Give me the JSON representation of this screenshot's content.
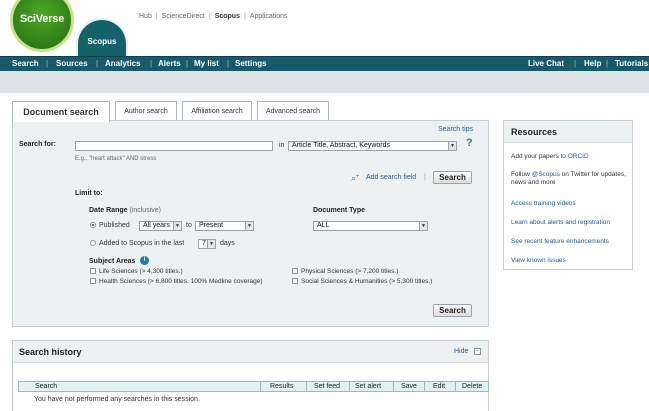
{
  "header": {
    "logo_sciverse": "SciVerse",
    "logo_scopus": "Scopus",
    "top_links": [
      {
        "label": "Hub",
        "active": false
      },
      {
        "label": "ScienceDirect",
        "active": false
      },
      {
        "label": "Scopus",
        "active": true
      },
      {
        "label": "Applications",
        "active": false
      }
    ]
  },
  "nav": {
    "left": [
      "Search",
      "Sources",
      "Analytics",
      "Alerts",
      "My list",
      "Settings"
    ],
    "right": [
      "Live Chat",
      "Help",
      "Tutorials"
    ]
  },
  "search": {
    "tabs": [
      "Document search",
      "Author search",
      "Affiliation search",
      "Advanced search"
    ],
    "search_tips": "Search tips",
    "search_for_label": "Search for:",
    "query_value": "",
    "in_label": "in",
    "field_select": "Article Title, Abstract, Keywords",
    "example": "E.g., \"heart attack\" AND stress",
    "add_search_field": "Add search field",
    "search_button": "Search",
    "limit_to": "Limit to:",
    "date_range_label": "Date Range",
    "date_range_note": "(inclusive)",
    "published_label": "Published",
    "published_from": "All years",
    "to_label": "to",
    "published_to": "Present",
    "added_label": "Added to Scopus in the last",
    "added_days_value": "7",
    "days_label": "days",
    "document_type_label": "Document Type",
    "document_type_value": "ALL",
    "subject_areas_label": "Subject Areas",
    "subjects": [
      "Life Sciences (> 4,300 titles.)",
      "Health Sciences (> 6,800 titles. 100% Medline coverage)",
      "Physical Sciences (> 7,200 titles.)",
      "Social Sciences & Humanities (> 5,300 titles.)"
    ]
  },
  "resources": {
    "title": "Resources",
    "items": [
      {
        "text": "Add your papers to ",
        "link": "ORCID"
      },
      {
        "text": "Follow ",
        "link": "@Scopus",
        "after": " on Twitter for updates, news and more"
      },
      {
        "link": "Access training videos"
      },
      {
        "link": "Learn about alerts and registration"
      },
      {
        "link": "See recent feature enhancements"
      },
      {
        "link": "View known issues"
      }
    ]
  },
  "history": {
    "title": "Search history",
    "hide_label": "Hide",
    "columns": [
      "Search",
      "Results",
      "Set feed",
      "Set alert",
      "Save",
      "Edit",
      "Delete"
    ],
    "empty_message": "You have not performed any searches in this session."
  },
  "colors": {
    "nav_bg": "#165a6b",
    "scopus_teal": "#13626a",
    "sciverse_green": "#2f7d16",
    "link_blue": "#1f5a9e"
  }
}
